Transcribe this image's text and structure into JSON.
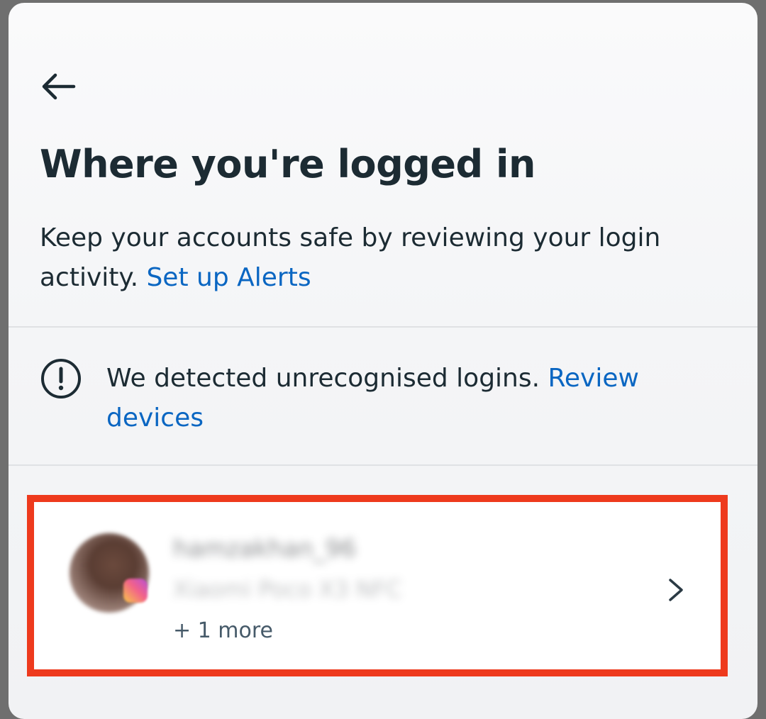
{
  "header": {
    "back_icon": "arrow-left-icon",
    "title": "Where you're logged in",
    "subtitle_text": "Keep your accounts safe by reviewing your login activity. ",
    "subtitle_link": "Set up Alerts"
  },
  "alert": {
    "icon": "exclamation-circle-icon",
    "text": "We detected unrecognised logins. ",
    "link": "Review devices"
  },
  "accounts": [
    {
      "username": "hamzakhan_96",
      "device": "Xiaomi Poco X3 NFC",
      "more": "+ 1 more",
      "avatar_badge": "instagram-icon",
      "chevron": "chevron-right-icon"
    }
  ],
  "colors": {
    "title_text": "#1c2b33",
    "link": "#0a66c2",
    "highlight_outline": "#ee3a1d",
    "divider": "#dfe1e4"
  }
}
